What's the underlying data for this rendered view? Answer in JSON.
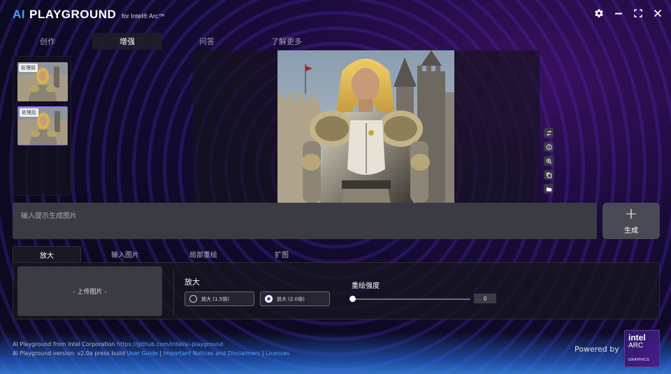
{
  "app": {
    "logo_ai": "AI",
    "logo_main": "PLAYGROUND",
    "logo_sub": "for Intel® Arc™"
  },
  "window_controls": {
    "settings_icon": "gear-icon",
    "minimize_icon": "minimize-icon",
    "fullscreen_icon": "fullscreen-icon",
    "close_icon": "close-icon"
  },
  "top_tabs": [
    {
      "label": "创作",
      "active": false
    },
    {
      "label": "增强",
      "active": true
    },
    {
      "label": "问答",
      "active": false
    },
    {
      "label": "了解更多",
      "active": false
    }
  ],
  "thumbnails": [
    {
      "tag": "处理前",
      "selected": false
    },
    {
      "tag": "处理后",
      "selected": true
    }
  ],
  "side_tools": [
    "swap-icon",
    "info-icon",
    "zoom-in-icon",
    "copy-icon",
    "folder-icon"
  ],
  "prompt": {
    "placeholder": "输入提示生成图片",
    "value": ""
  },
  "generate_button": {
    "icon": "plus-icon",
    "label": "生成"
  },
  "sub_tabs": [
    {
      "label": "放大",
      "active": true
    },
    {
      "label": "输入图片",
      "active": false
    },
    {
      "label": "局部重绘",
      "active": false
    },
    {
      "label": "扩图",
      "active": false
    }
  ],
  "enhance_panel": {
    "upload_label": "- 上传图片 -",
    "zoom_title": "放大",
    "zoom_options": [
      {
        "label": "放大 (1.5倍)",
        "checked": false
      },
      {
        "label": "放大 (2.0倍)",
        "checked": true
      }
    ],
    "strength_title": "重绘强度",
    "strength_value": "0"
  },
  "footer": {
    "line1_text": "AI Playground from Intel Corporation ",
    "line1_link": "https://github.com/intel/ai-playground",
    "line2_text": "AI Playground version: v2.0a press build ",
    "link_user_guide": "User Guide",
    "sep1": " | ",
    "link_notices": "Important Notices and Disclaimers",
    "sep2": " | ",
    "link_licenses": "Licenses"
  },
  "powered_by": "Powered by",
  "intel_badge": {
    "line1": "intel",
    "line2": "ARC",
    "line3": "GRAPHICS"
  },
  "colors": {
    "accent": "#3fa0ff",
    "selection": "#7f5cff",
    "link": "#5aa8ff"
  }
}
